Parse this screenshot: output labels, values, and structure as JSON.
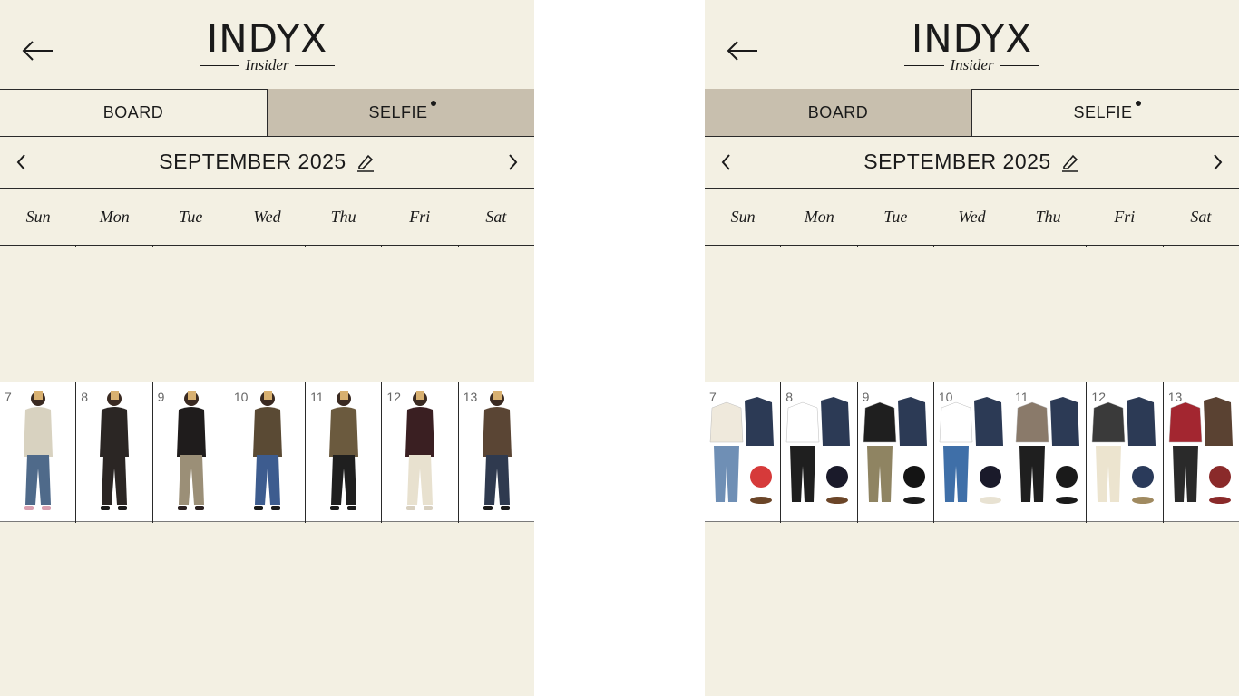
{
  "colors": {
    "background": "#f3f0e3",
    "active_tab": "#c8bfae",
    "border": "#2a2a2a"
  },
  "logo": {
    "main": "INDYX",
    "sub": "Insider"
  },
  "left_panel": {
    "tabs": [
      {
        "label": "BOARD",
        "active": false
      },
      {
        "label": "SELFIE",
        "active": true,
        "dot": true
      }
    ],
    "month": "SEPTEMBER 2025",
    "weekdays": [
      "Sun",
      "Mon",
      "Tue",
      "Wed",
      "Thu",
      "Fri",
      "Sat"
    ],
    "days": [
      "7",
      "8",
      "9",
      "10",
      "11",
      "12",
      "13"
    ]
  },
  "right_panel": {
    "tabs": [
      {
        "label": "BOARD",
        "active": true
      },
      {
        "label": "SELFIE",
        "active": false,
        "dot": true
      }
    ],
    "month": "SEPTEMBER 2025",
    "weekdays": [
      "Sun",
      "Mon",
      "Tue",
      "Wed",
      "Thu",
      "Fri",
      "Sat"
    ],
    "days": [
      "7",
      "8",
      "9",
      "10",
      "11",
      "12",
      "13"
    ]
  },
  "icons": {
    "back": "arrow-left-icon",
    "prev": "chevron-left-icon",
    "next": "chevron-right-icon",
    "edit": "pencil-icon",
    "dot": "notification-dot-icon"
  }
}
